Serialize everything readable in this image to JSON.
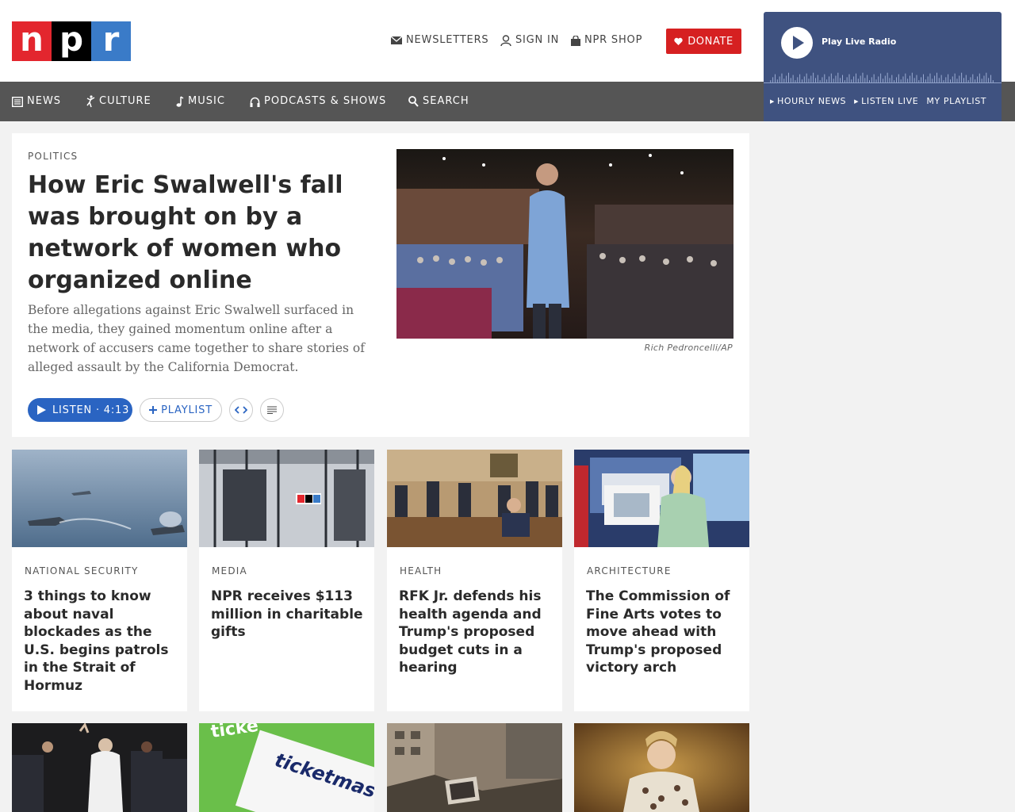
{
  "header": {
    "logo": {
      "letters": [
        "n",
        "p",
        "r"
      ],
      "colors": [
        "#e3262e",
        "#000000",
        "#3a7bc8"
      ]
    },
    "utility_links": [
      {
        "icon": "envelope-icon",
        "label": "NEWSLETTERS"
      },
      {
        "icon": "user-icon",
        "label": "SIGN IN"
      },
      {
        "icon": "shopping-bag-icon",
        "label": "NPR SHOP"
      }
    ],
    "donate": {
      "icon": "heart-icon",
      "label": "DONATE",
      "color": "#d62021"
    }
  },
  "nav": {
    "items": [
      {
        "icon": "newspaper-icon",
        "label": "NEWS"
      },
      {
        "icon": "dancer-icon",
        "label": "CULTURE"
      },
      {
        "icon": "music-note-icon",
        "label": "MUSIC"
      },
      {
        "icon": "headphones-icon",
        "label": "PODCASTS & SHOWS"
      },
      {
        "icon": "search-icon",
        "label": "SEARCH"
      }
    ]
  },
  "player": {
    "title": "Play Live Radio",
    "links": [
      "HOURLY NEWS",
      "LISTEN LIVE",
      "MY PLAYLIST"
    ],
    "color": "#3f5280"
  },
  "hero": {
    "section": "POLITICS",
    "title": "How Eric Swalwell's fall was brought on by a network of women who organized online",
    "teaser": "Before allegations against Eric Swalwell surfaced in the media, they gained momentum online after a network of accusers came together to share stories of alleged assault by the California Democrat.",
    "image_credit": "Rich Pedroncelli/AP",
    "listen_label": "LISTEN · 4:13",
    "playlist_label": "PLAYLIST",
    "accent": "#2a64c2"
  },
  "stories": [
    {
      "section": "NATIONAL SECURITY",
      "title": "3 things to know about naval blockades as the U.S. begins patrols in the Strait of Hormuz"
    },
    {
      "section": "MEDIA",
      "title": "NPR receives $113 million in charitable gifts"
    },
    {
      "section": "HEALTH",
      "title": "RFK Jr. defends his health agenda and Trump's proposed budget cuts in a hearing"
    },
    {
      "section": "ARCHITECTURE",
      "title": "The Commission of Fine Arts votes to move ahead with Trump's proposed victory arch"
    }
  ],
  "second_row_images": {
    "ticket_text": "ticketmaster",
    "ticket_top_text": "ticke"
  }
}
